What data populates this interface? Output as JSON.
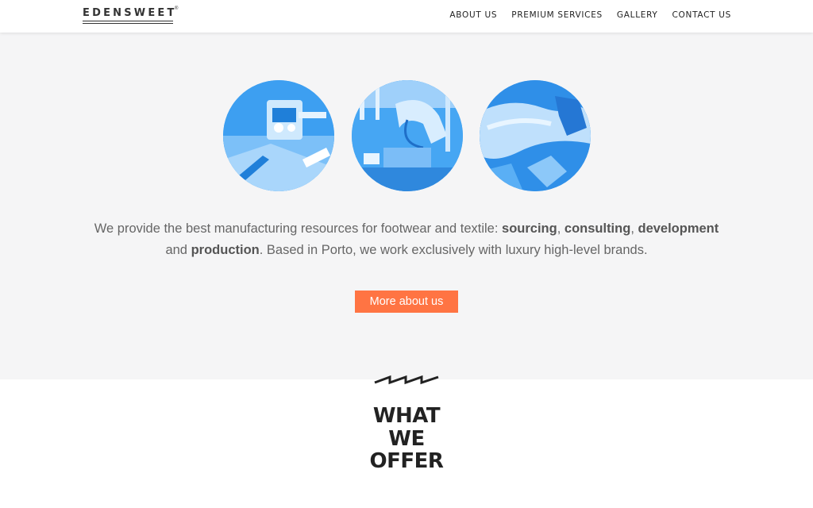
{
  "brand": {
    "name": "EDENSWEET",
    "registered_mark": "®"
  },
  "nav": {
    "items": [
      "ABOUT US",
      "PREMIUM SERVICES",
      "GALLERY",
      "CONTACT US"
    ]
  },
  "hero": {
    "images": [
      "footwear-machine-photo",
      "robotic-arm-photo",
      "leather-crafting-photo"
    ],
    "tint_color": "#3da0f2",
    "intro": {
      "t1": "We provide the best manufacturing resources for footwear and textile: ",
      "sourcing": "sourcing",
      "sep1": ", ",
      "consulting": "consulting",
      "sep2": ", ",
      "development": "development",
      "t2": " and ",
      "production": "production",
      "t3": ". Based in Porto, we work exclusively with luxury high-level brands."
    },
    "cta_label": "More about us",
    "cta_color": "#ff7443"
  },
  "offer": {
    "heading_line1": "WHAT",
    "heading_line2": "WE",
    "heading_line3": "OFFER"
  }
}
